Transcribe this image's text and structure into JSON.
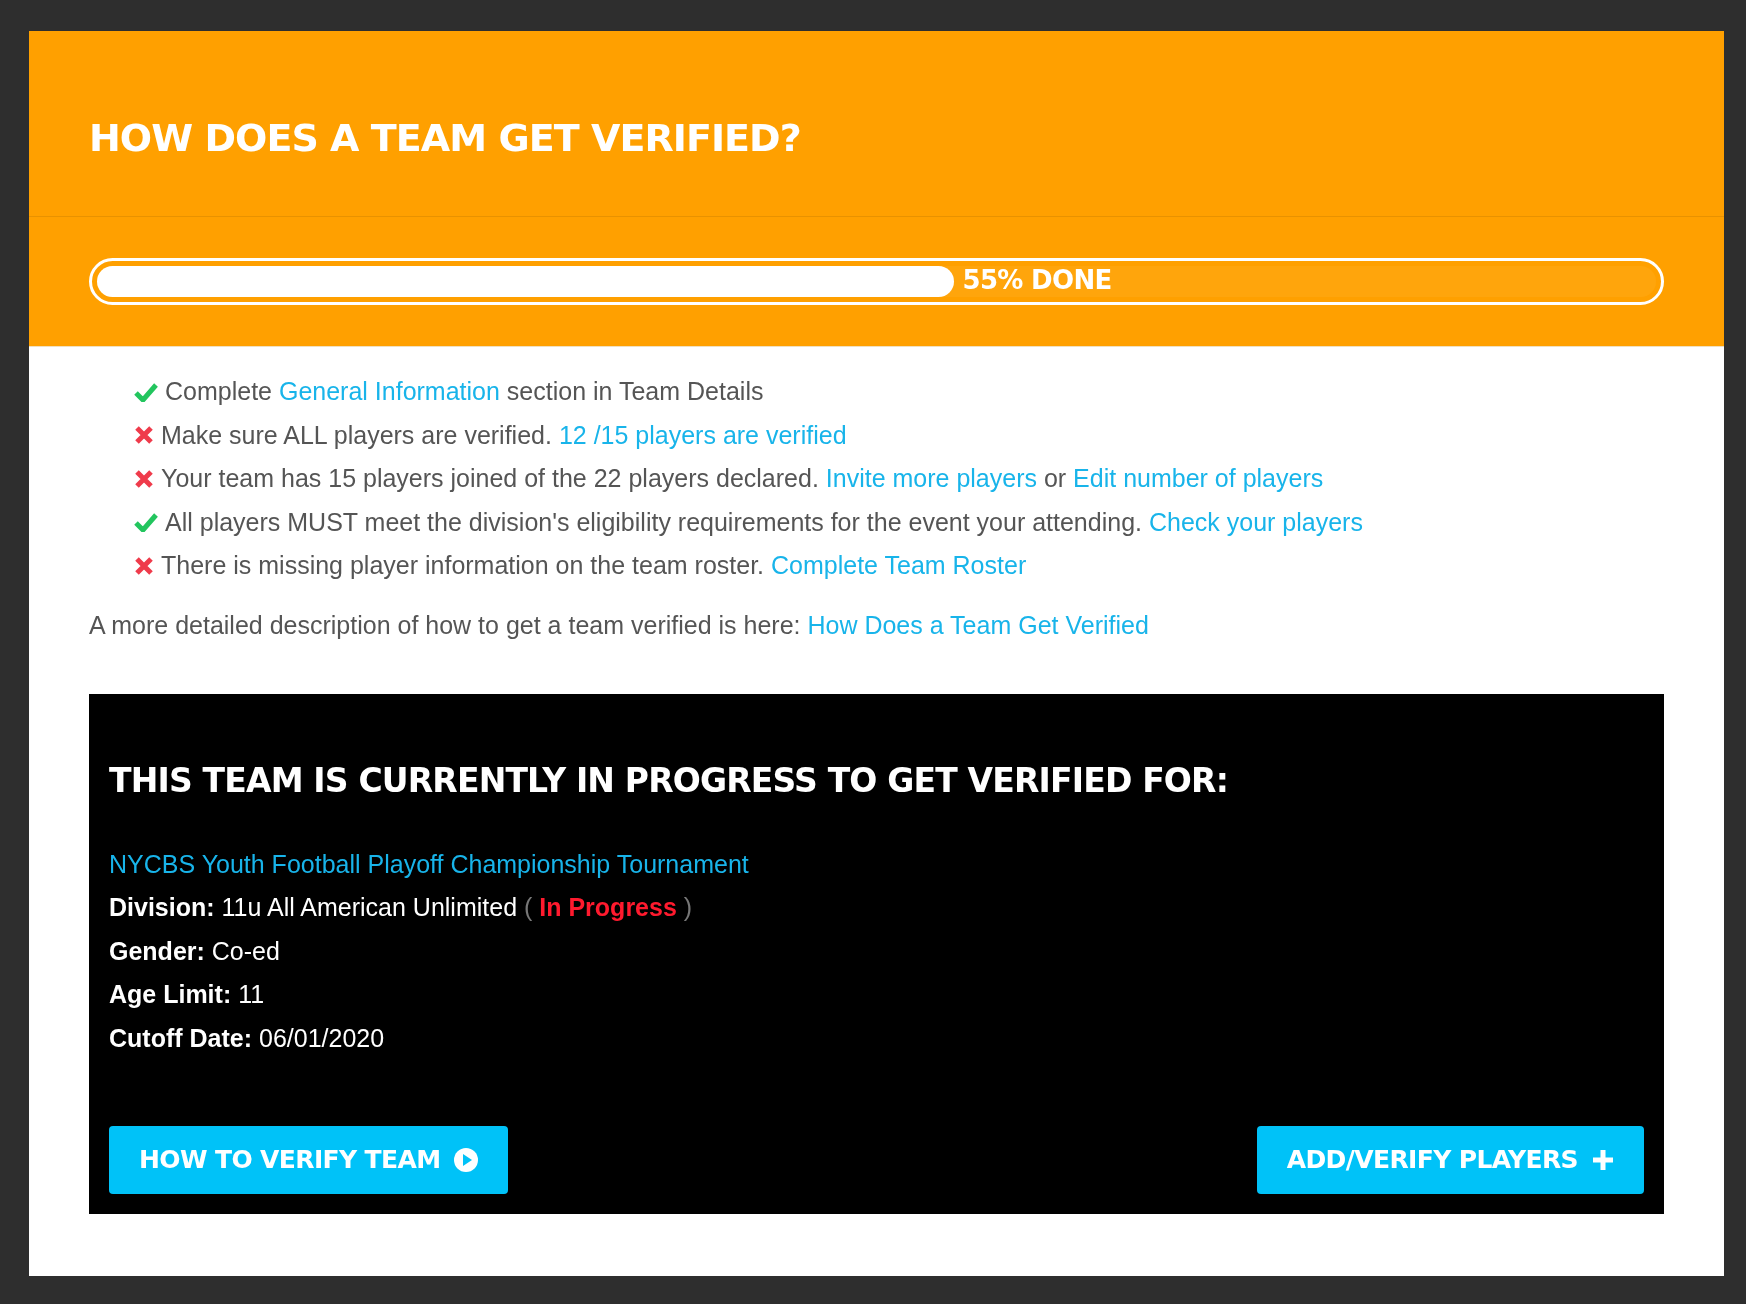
{
  "header": {
    "title": "HOW DOES A TEAM GET VERIFIED?"
  },
  "progress": {
    "level": 0.55,
    "label": "55% DONE"
  },
  "checklist": [
    {
      "done": true,
      "segments": [
        {
          "kind": "text",
          "text": "Complete "
        },
        {
          "kind": "link",
          "text": "General Information"
        },
        {
          "kind": "text",
          "text": " section in Team Details"
        }
      ]
    },
    {
      "done": false,
      "segments": [
        {
          "kind": "text",
          "text": "Make sure ALL players are verified. "
        },
        {
          "kind": "link",
          "text": "12 /15 players are verified"
        }
      ]
    },
    {
      "done": false,
      "segments": [
        {
          "kind": "text",
          "text": "Your team has 15 players joined of the 22 players declared. "
        },
        {
          "kind": "link",
          "text": "Invite more players"
        },
        {
          "kind": "text",
          "text": " or "
        },
        {
          "kind": "link",
          "text": "Edit number of players"
        }
      ]
    },
    {
      "done": true,
      "segments": [
        {
          "kind": "text",
          "text": "All players MUST meet the division's eligibility requirements for the event your attending. "
        },
        {
          "kind": "link",
          "text": "Check your players"
        }
      ]
    },
    {
      "done": false,
      "segments": [
        {
          "kind": "text",
          "text": "There is missing player information on the team roster. "
        },
        {
          "kind": "link",
          "text": "Complete Team Roster"
        }
      ]
    }
  ],
  "description": {
    "text": "A more detailed description of how to get a team verified is here: ",
    "link": "How Does a Team Get Verified"
  },
  "status_panel": {
    "title": "THIS TEAM IS CURRENTLY IN PROGRESS TO GET VERIFIED FOR:",
    "event_link": "NYCBS Youth Football Playoff Championship Tournament",
    "division": {
      "label": "Division:",
      "value": "11u All American Unlimited",
      "open": "(",
      "status": "In Progress",
      "close": ")"
    },
    "fields": [
      {
        "label": "Gender:",
        "value": "Co-ed"
      },
      {
        "label": "Age Limit:",
        "value": "11"
      },
      {
        "label": "Cutoff Date:",
        "value": "06/01/2020"
      }
    ],
    "buttons": [
      {
        "kind": "play",
        "label": "HOW TO VERIFY TEAM"
      },
      {
        "kind": "plus",
        "label": "ADD/VERIFY PLAYERS"
      }
    ]
  }
}
